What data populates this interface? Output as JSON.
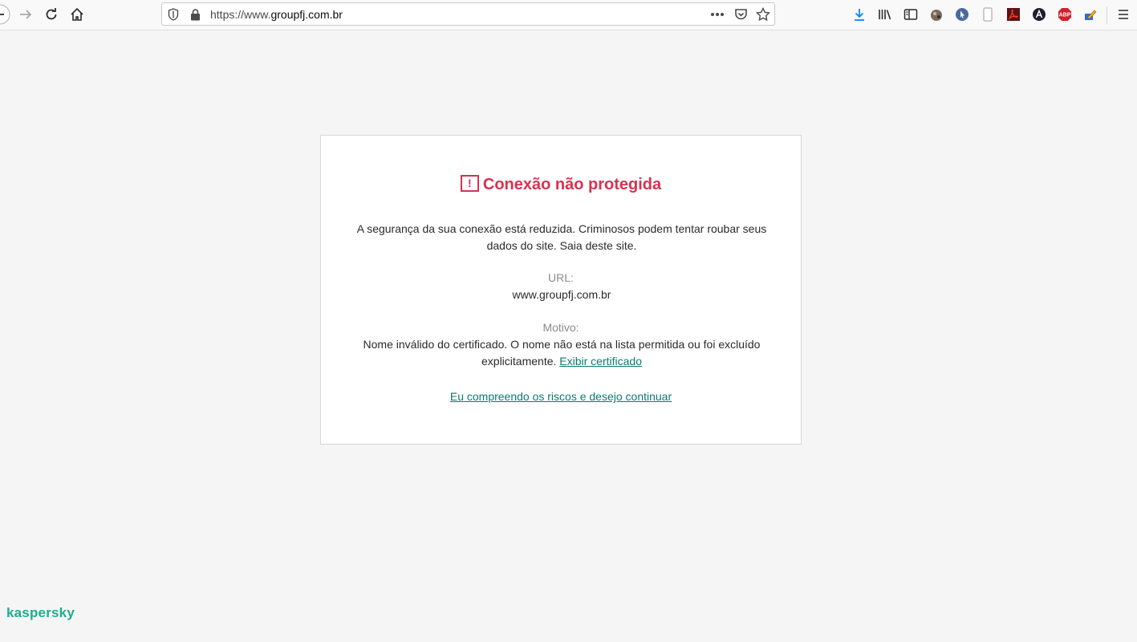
{
  "browser": {
    "url_scheme": "https://www.",
    "url_host": "groupfj.com.br",
    "page_actions_icon": "more-horizontal-icon",
    "pocket_icon": "pocket-icon",
    "bookmark_icon": "star-icon",
    "extensions": [
      {
        "name": "abp-icon",
        "label": "ABP",
        "color": "#d2202a"
      }
    ]
  },
  "warning": {
    "title": "Conexão não protegida",
    "icon": "!",
    "description": "A segurança da sua conexão está reduzida. Criminosos podem tentar roubar seus dados do site. Saia deste site.",
    "url_label": "URL:",
    "url_value": "www.groupfj.com.br",
    "reason_label": "Motivo:",
    "reason_text": "Nome inválido do certificado. O nome não está na lista permitida ou foi excluído explicitamente.",
    "view_cert_link": "Exibir certificado",
    "continue_link": "Eu compreendo os riscos e desejo continuar"
  },
  "brand": "kaspersky",
  "colors": {
    "danger": "#d9314f",
    "link": "#0b7a6e",
    "brand": "#1aaf8b",
    "background": "#f5f5f5"
  }
}
